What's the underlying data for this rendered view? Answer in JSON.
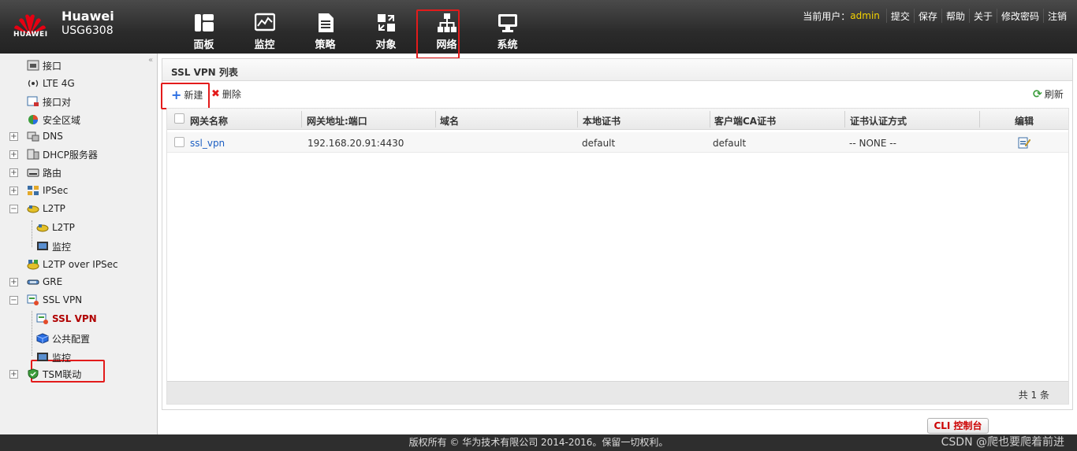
{
  "brand": {
    "name": "Huawei",
    "model": "USG6308",
    "logo_text": "HUAWEI"
  },
  "nav": [
    {
      "label": "面板",
      "icon": "dashboard-icon"
    },
    {
      "label": "监控",
      "icon": "monitor-chart-icon"
    },
    {
      "label": "策略",
      "icon": "policy-document-icon"
    },
    {
      "label": "对象",
      "icon": "object-icon"
    },
    {
      "label": "网络",
      "icon": "network-topology-icon",
      "active": true
    },
    {
      "label": "系统",
      "icon": "system-computer-icon"
    }
  ],
  "userbar": {
    "user_label": "当前用户：",
    "user_name": "admin",
    "links": [
      "提交",
      "保存",
      "帮助",
      "关于",
      "修改密码",
      "注销"
    ]
  },
  "sidebar": {
    "items": [
      {
        "label": "接口",
        "icon": "interface-icon"
      },
      {
        "label": "LTE 4G",
        "icon": "signal-icon"
      },
      {
        "label": "接口对",
        "icon": "interface-pair-icon"
      },
      {
        "label": "安全区域",
        "icon": "security-zone-icon"
      },
      {
        "label": "DNS",
        "icon": "dns-icon",
        "toggle": "+"
      },
      {
        "label": "DHCP服务器",
        "icon": "dhcp-server-icon",
        "toggle": "+"
      },
      {
        "label": "路由",
        "icon": "router-icon",
        "toggle": "+"
      },
      {
        "label": "IPSec",
        "icon": "ipsec-icon",
        "toggle": "+"
      },
      {
        "label": "L2TP",
        "icon": "l2tp-icon",
        "toggle": "−"
      },
      {
        "label": "L2TP",
        "icon": "l2tp-icon"
      },
      {
        "label": "监控",
        "icon": "monitor-screen-icon"
      },
      {
        "label": "L2TP over IPSec",
        "icon": "l2tp-ipsec-icon"
      },
      {
        "label": "GRE",
        "icon": "gre-icon",
        "toggle": "+"
      },
      {
        "label": "SSL VPN",
        "icon": "sslvpn-icon",
        "toggle": "−"
      },
      {
        "label": "SSL VPN",
        "icon": "sslvpn-icon",
        "selected": true
      },
      {
        "label": "公共配置",
        "icon": "cube-icon"
      },
      {
        "label": "监控",
        "icon": "monitor-screen-icon"
      },
      {
        "label": "TSM联动",
        "icon": "tsm-shield-icon",
        "toggle": "+"
      }
    ]
  },
  "panel": {
    "title": "SSL VPN 列表",
    "toolbar": {
      "new_label": "新建",
      "delete_label": "删除",
      "refresh_label": "刷新"
    },
    "columns": [
      "网关名称",
      "网关地址:端口",
      "域名",
      "本地证书",
      "客户端CA证书",
      "证书认证方式",
      "编辑"
    ],
    "rows": [
      {
        "name": "ssl_vpn",
        "address": "192.168.20.91:4430",
        "domain": "",
        "local_cert": "default",
        "client_ca": "default",
        "auth_mode": "-- NONE --"
      }
    ],
    "total": "共 1 条"
  },
  "cli_button": "CLI 控制台",
  "footer": "版权所有 © 华为技术有限公司 2014-2016。保留一切权利。",
  "watermark": "CSDN @爬也要爬着前进",
  "colors": {
    "accent_red": "#e31b1b",
    "user_name": "#f5d300",
    "link": "#1b5ec2"
  }
}
